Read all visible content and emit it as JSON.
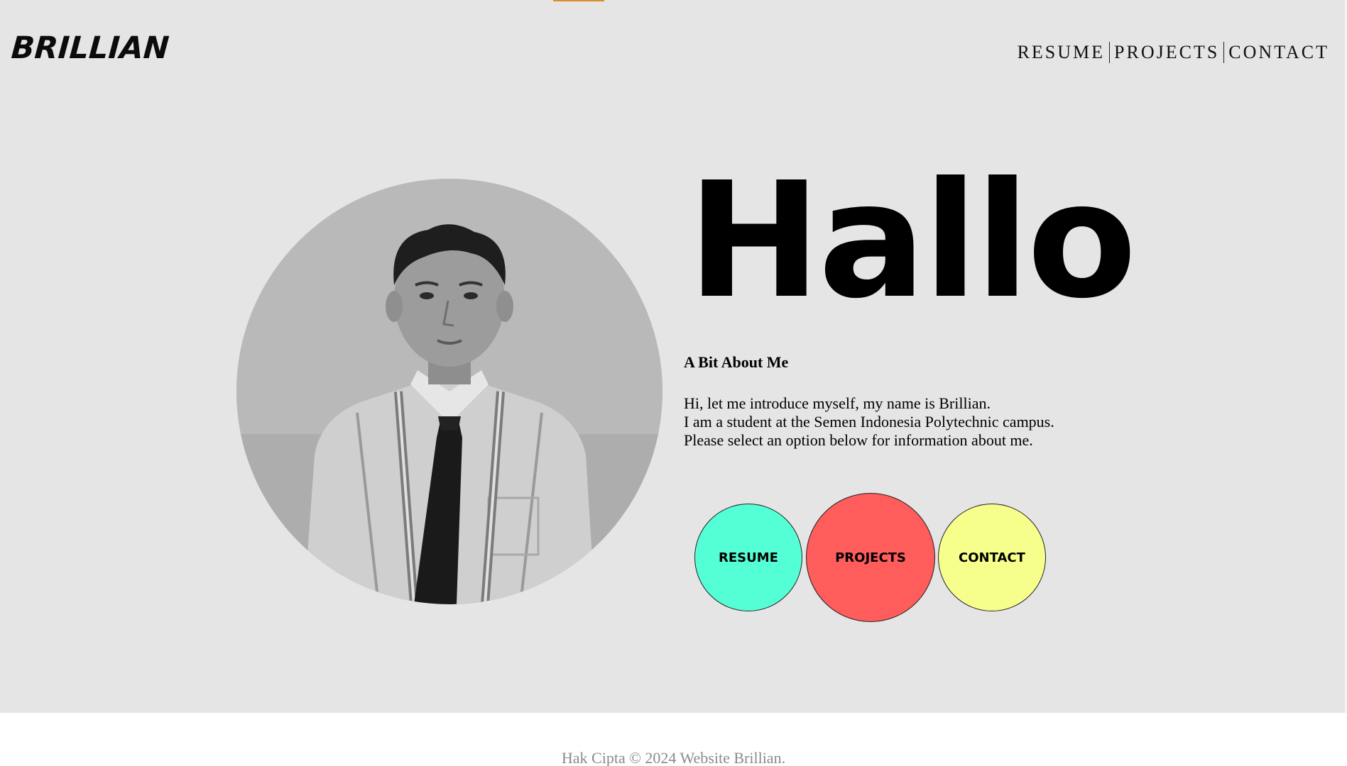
{
  "header": {
    "brand": "BRILLIAN",
    "nav": [
      "RESUME",
      "PROJECTS",
      "CONTACT"
    ]
  },
  "hero": {
    "greeting": "Hallo",
    "about_title": "A Bit About Me",
    "intro_lines": [
      "Hi, let me introduce myself, my name is Brillian.",
      "I am a student at the Semen Indonesia Polytechnic campus.",
      "Please select an option below for information about me."
    ],
    "buttons": {
      "resume": "RESUME",
      "projects": "PROJECTS",
      "contact": "CONTACT"
    }
  },
  "footer": {
    "copyright": "Hak Cipta © 2024 Website Brillian."
  },
  "colors": {
    "background": "#e5e5e5",
    "accent": "#d98e2b",
    "resume_button": "#55ffd6",
    "projects_button": "#ff5c5c",
    "contact_button": "#f7ff8c"
  }
}
